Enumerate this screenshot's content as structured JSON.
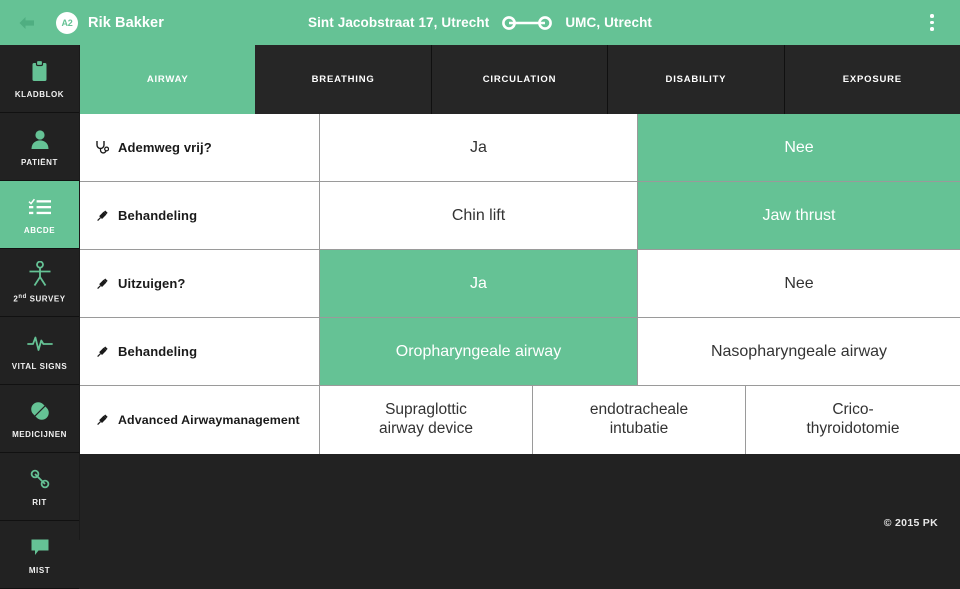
{
  "topbar": {
    "back_icon": "back-arrow-icon",
    "avatar_label": "A2",
    "patient_name": "Rik Bakker",
    "route_from": "Sint Jacobstraat 17, Utrecht",
    "route_link_icon": "route-connector-icon",
    "route_to": "UMC, Utrecht",
    "menu_icon": "overflow-menu-icon",
    "accent_color": "#65c295"
  },
  "sidebar": {
    "items": [
      {
        "label": "KLADBLOK",
        "icon": "clipboard-icon",
        "active": false
      },
      {
        "label": "PATIËNT",
        "icon": "person-icon",
        "active": false
      },
      {
        "label": "ABCDE",
        "icon": "checklist-icon",
        "active": true
      },
      {
        "label": "2nd SURVEY",
        "label_main": "SURVEY",
        "label_prefix": "2",
        "label_sup": "nd",
        "icon": "body-figure-icon",
        "active": false
      },
      {
        "label": "VITAL SIGNS",
        "icon": "heartbeat-icon",
        "active": false
      },
      {
        "label": "MEDICIJNEN",
        "icon": "pill-icon",
        "active": false
      },
      {
        "label": "RIT",
        "icon": "route-node-icon",
        "active": false
      },
      {
        "label": "MIST",
        "icon": "speech-bubble-icon",
        "active": false
      }
    ]
  },
  "tabs": [
    {
      "label": "AIRWAY",
      "active": true
    },
    {
      "label": "BREATHING",
      "active": false
    },
    {
      "label": "CIRCULATION",
      "active": false
    },
    {
      "label": "DISABILITY",
      "active": false
    },
    {
      "label": "EXPOSURE",
      "active": false
    }
  ],
  "rows": [
    {
      "label": "Ademweg vrij?",
      "icon": "stethoscope-icon",
      "options": [
        {
          "text": "Ja",
          "selected": false
        },
        {
          "text": "Nee",
          "selected": true
        }
      ]
    },
    {
      "label": "Behandeling",
      "icon": "syringe-icon",
      "options": [
        {
          "text": "Chin lift",
          "selected": false
        },
        {
          "text": "Jaw thrust",
          "selected": true
        }
      ]
    },
    {
      "label": "Uitzuigen?",
      "icon": "syringe-icon",
      "options": [
        {
          "text": "Ja",
          "selected": true
        },
        {
          "text": "Nee",
          "selected": false
        }
      ]
    },
    {
      "label": "Behandeling",
      "icon": "syringe-icon",
      "options": [
        {
          "text": "Oropharyngeale airway",
          "selected": true
        },
        {
          "text": "Nasopharyngeale airway",
          "selected": false
        }
      ]
    },
    {
      "label": "Advanced Airwaymanagement",
      "icon": "syringe-icon",
      "options": [
        {
          "text": "Supraglottic airway device",
          "line1": "Supraglottic",
          "line2": "airway device",
          "selected": false
        },
        {
          "text": "endotracheale intubatie",
          "line1": "endotracheale",
          "line2": "intubatie",
          "selected": false
        },
        {
          "text": "Crico-thyroidotomie",
          "line1": "Crico-",
          "line2": "thyroidotomie",
          "selected": false
        }
      ]
    }
  ],
  "footer": {
    "copyright": "© 2015 PK"
  }
}
